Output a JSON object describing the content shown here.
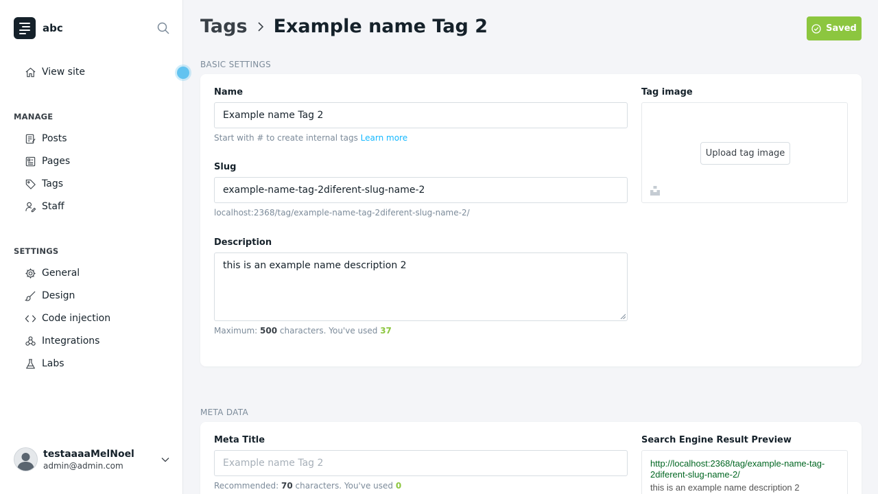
{
  "app": {
    "site_name": "abc"
  },
  "sidebar": {
    "view_site": "View site",
    "manage_heading": "MANAGE",
    "manage_items": [
      {
        "label": "Posts",
        "icon": "posts-icon"
      },
      {
        "label": "Pages",
        "icon": "pages-icon"
      },
      {
        "label": "Tags",
        "icon": "tag-icon"
      },
      {
        "label": "Staff",
        "icon": "staff-icon"
      }
    ],
    "settings_heading": "SETTINGS",
    "settings_items": [
      {
        "label": "General",
        "icon": "gear-icon"
      },
      {
        "label": "Design",
        "icon": "brush-icon"
      },
      {
        "label": "Code injection",
        "icon": "code-icon"
      },
      {
        "label": "Integrations",
        "icon": "integrations-icon"
      },
      {
        "label": "Labs",
        "icon": "flask-icon"
      }
    ],
    "user": {
      "name": "testaaaaMelNoel",
      "email": "admin@admin.com"
    }
  },
  "header": {
    "breadcrumb_parent": "Tags",
    "breadcrumb_current": "Example name Tag 2",
    "saved_label": "Saved"
  },
  "basic": {
    "section_title": "BASIC SETTINGS",
    "name_label": "Name",
    "name_value": "Example name Tag 2",
    "name_hint": "Start with # to create internal tags",
    "learn_more": "Learn more",
    "slug_label": "Slug",
    "slug_value": "example-name-tag-2diferent-slug-name-2",
    "slug_url": "localhost:2368/tag/example-name-tag-2diferent-slug-name-2/",
    "description_label": "Description",
    "description_value": "this is an example name description 2",
    "desc_hint_prefix": "Maximum:",
    "desc_max": "500",
    "desc_hint_mid": "characters. You've used",
    "desc_used": "37",
    "image_label": "Tag image",
    "upload_label": "Upload tag image"
  },
  "meta": {
    "section_title": "META DATA",
    "title_label": "Meta Title",
    "title_placeholder": "Example name Tag 2",
    "title_hint_prefix": "Recommended:",
    "title_recommended": "70",
    "title_hint_mid": "characters. You've used",
    "title_used": "0",
    "serp_label": "Search Engine Result Preview",
    "serp_url": "http://localhost:2368/tag/example-name-tag-2diferent-slug-name-2/",
    "serp_description": "this is an example name description 2"
  },
  "colors": {
    "accent_green": "#8cc63f",
    "link_blue": "#14b8ff",
    "tour_dot": "#62c3f0"
  }
}
